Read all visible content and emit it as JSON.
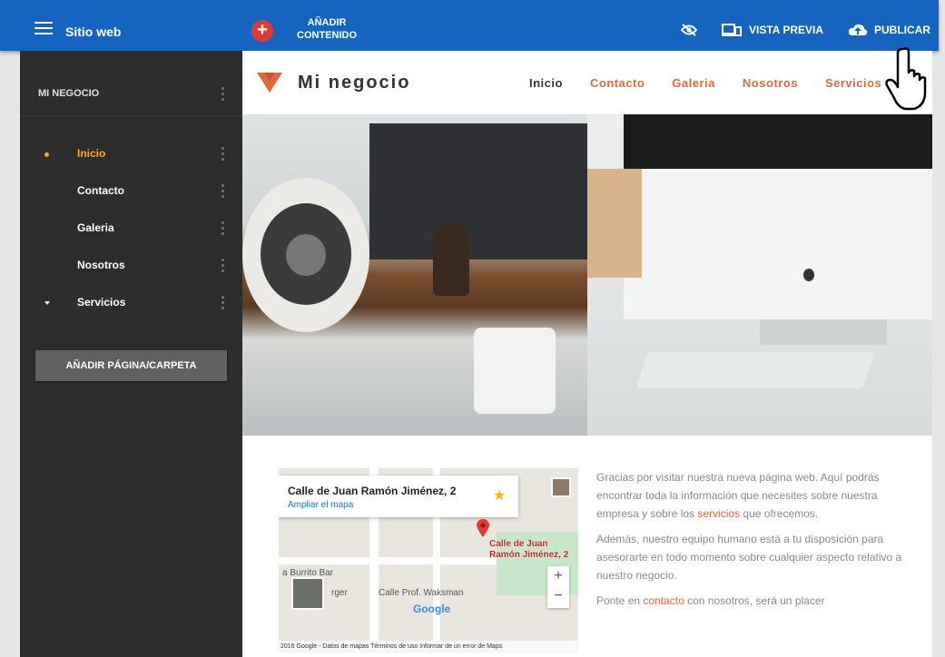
{
  "topbar": {
    "title": "Sitio web",
    "add_content": "AÑADIR CONTENIDO",
    "preview": "VISTA PREVIA",
    "publish": "PUBLICAR",
    "accent": "#1565c0"
  },
  "sidebar": {
    "section_title": "MI NEGOCIO",
    "items": [
      {
        "label": "Inicio",
        "active": true
      },
      {
        "label": "Contacto"
      },
      {
        "label": "Galeria"
      },
      {
        "label": "Nosotros"
      },
      {
        "label": "Servicios",
        "expandable": true
      }
    ],
    "add_page": "AÑADIR PÁGINA/CARPETA"
  },
  "site": {
    "brand": "Mi negocio",
    "nav": [
      "Inicio",
      "Contacto",
      "Galeria",
      "Nosotros",
      "Servicios"
    ],
    "accent": "#e06a3c"
  },
  "map": {
    "title": "Calle de Juan Ramón Jiménez, 2",
    "link": "Ampliar el mapa",
    "place_label_1": "Calle de Juan",
    "place_label_2": "Ramón Jiménez, 2",
    "street_1": "a Burrito Bar",
    "street_2": "Calle Prof. Waksman",
    "street_3": "rger",
    "google": "Google",
    "attribution": "2016 Google - Datos de mapas   Términos de uso   Informar de un error de Maps"
  },
  "intro": {
    "p1_a": "Gracias por visitar nuestra nueva página web. Aquí podrás encontrar toda la información que necesites sobre nuestra empresa y sobre los ",
    "p1_link": "servicios",
    "p1_b": " que ofrecemos.",
    "p2": "Además, nuestro equipo humano está a tu disposición para asesorarte en todo momento sobre cualquier aspecto relativo a nuestro negocio.",
    "p3_a": "Ponte en ",
    "p3_link": "contacto",
    "p3_b": " con nosotros, será un placer"
  }
}
